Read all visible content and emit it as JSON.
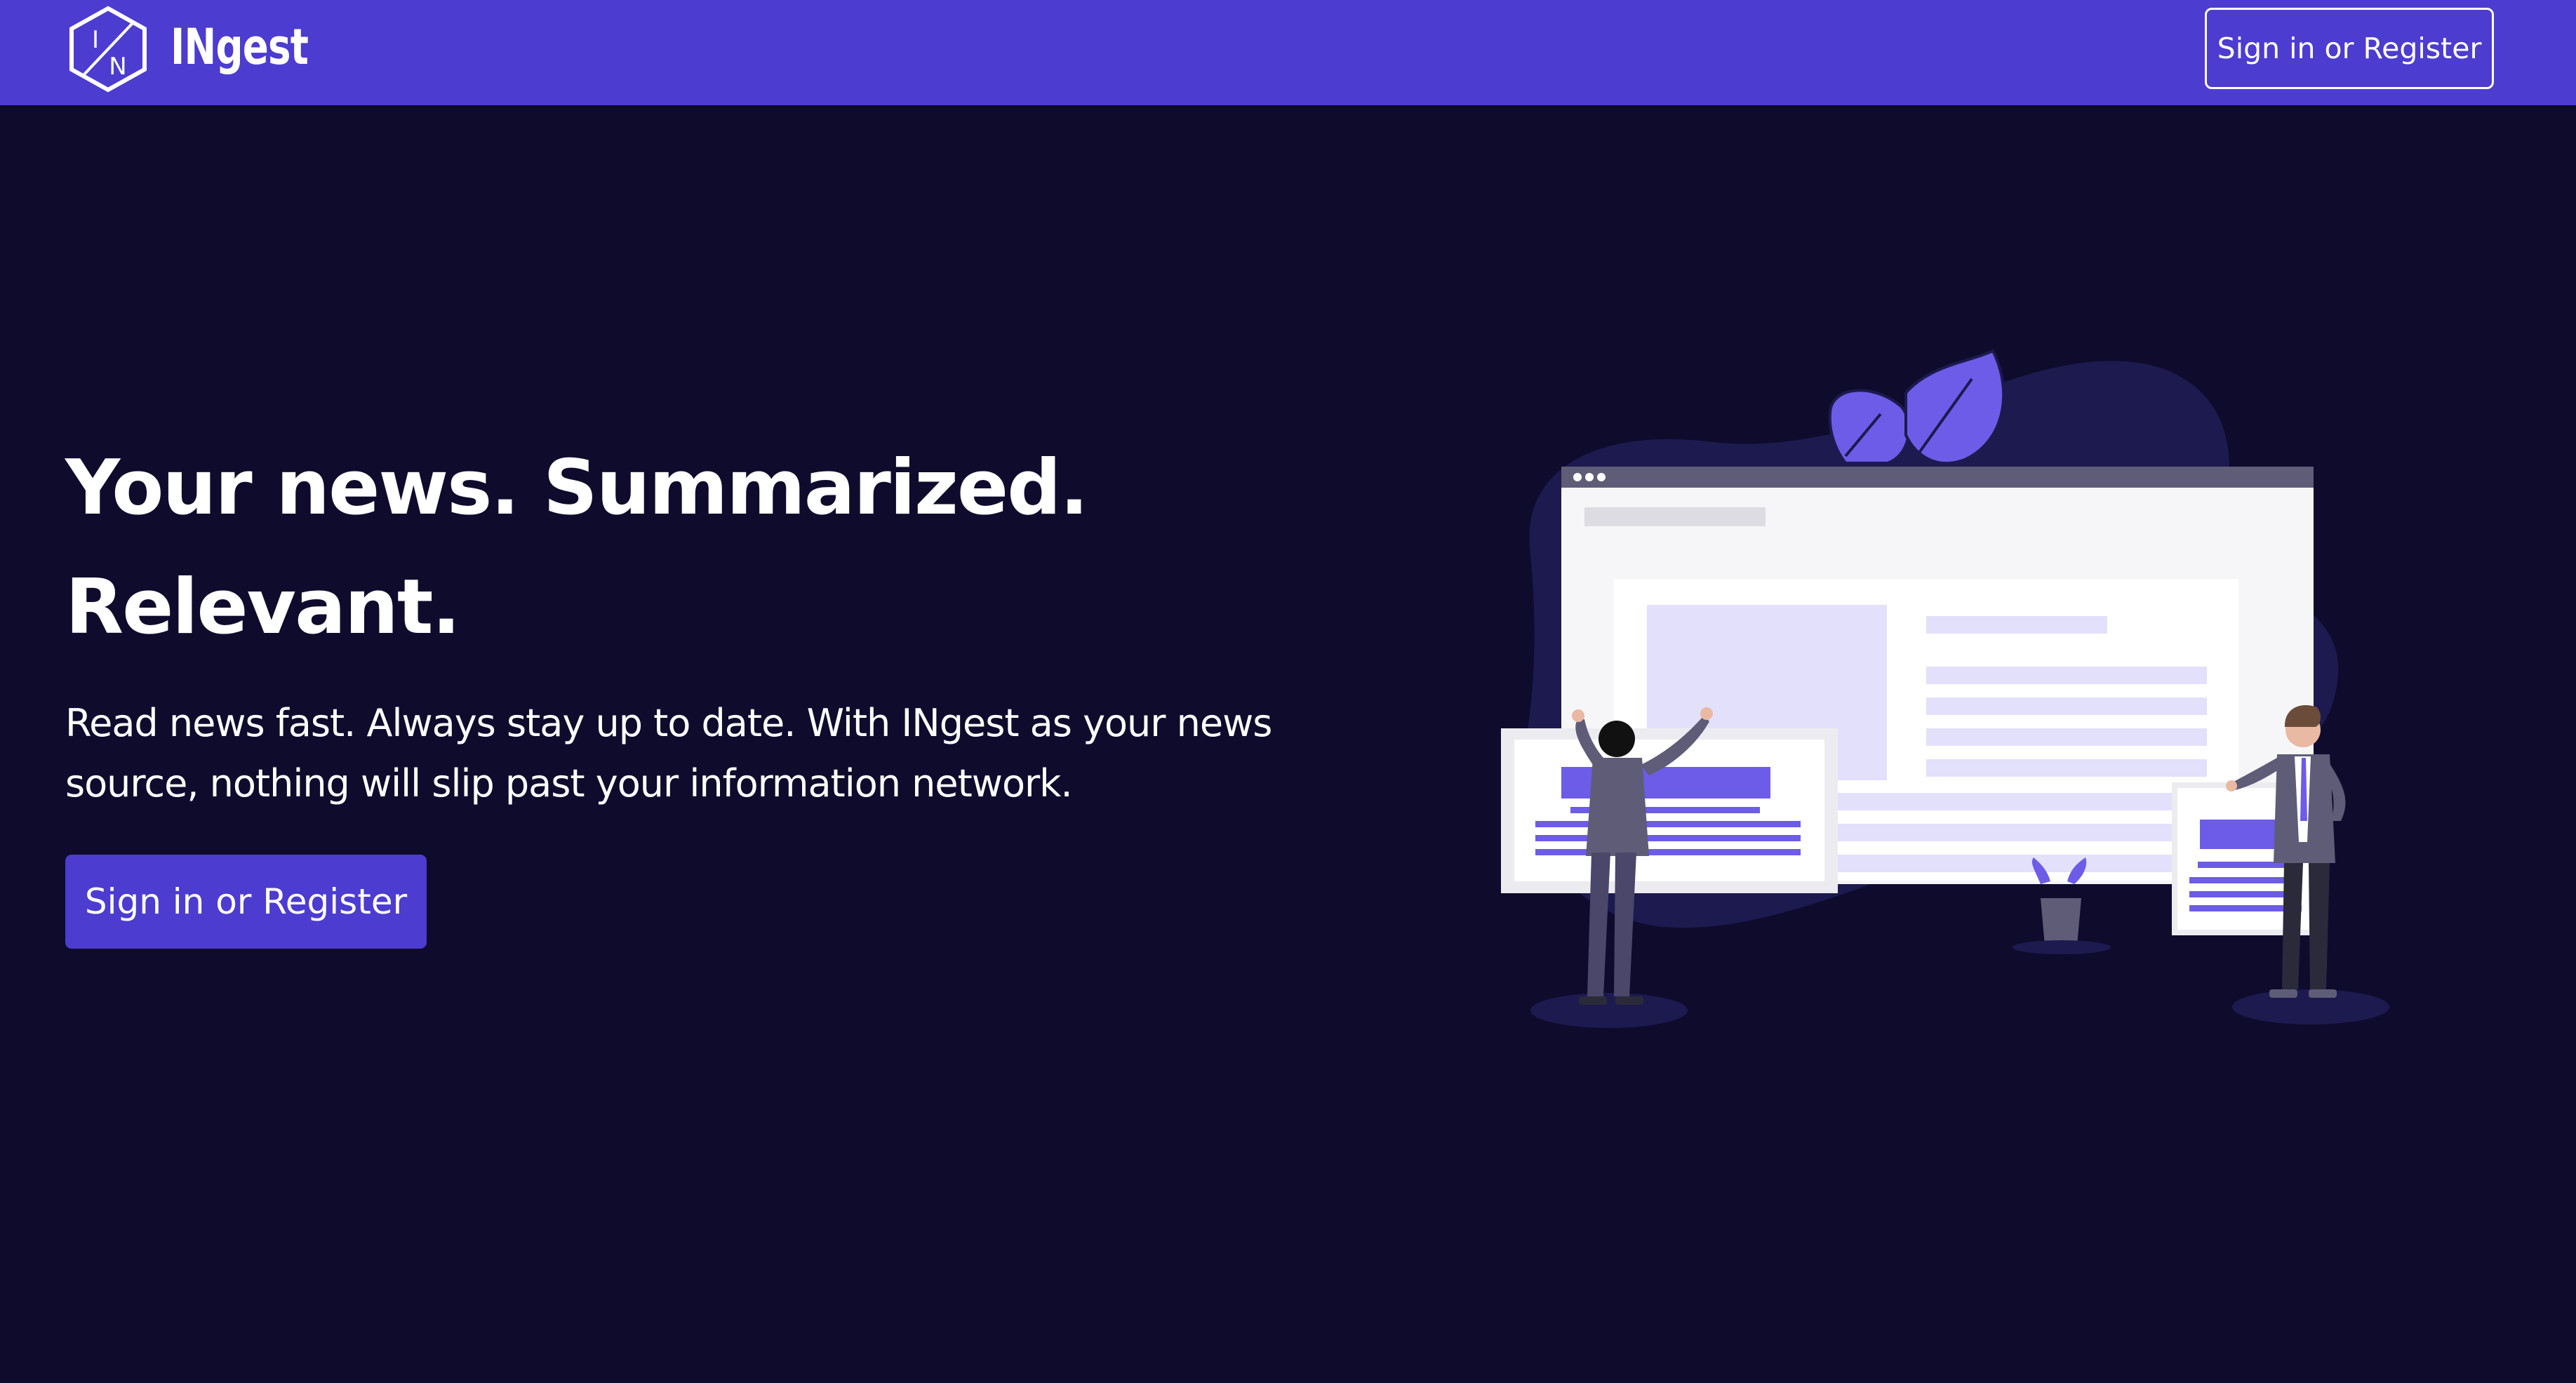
{
  "navbar": {
    "brand": "INgest",
    "logo_letters": [
      "I",
      "N"
    ],
    "signin_label": "Sign in or Register"
  },
  "hero": {
    "headline_line1": "Your news. Summarized.",
    "headline_line2": "Relevant.",
    "subtext": "Read news fast. Always stay up to date. With INgest as your news source, nothing will slip past your information network.",
    "cta_label": "Sign in or Register"
  },
  "colors": {
    "navbar": "#4c3ccf",
    "background": "#0e0b2d",
    "accent": "#6c5ce7",
    "text": "#ffffff"
  },
  "icons": {
    "logo": "hexagon-in-logo-icon",
    "illustration": "people-reading-news-illustration"
  }
}
